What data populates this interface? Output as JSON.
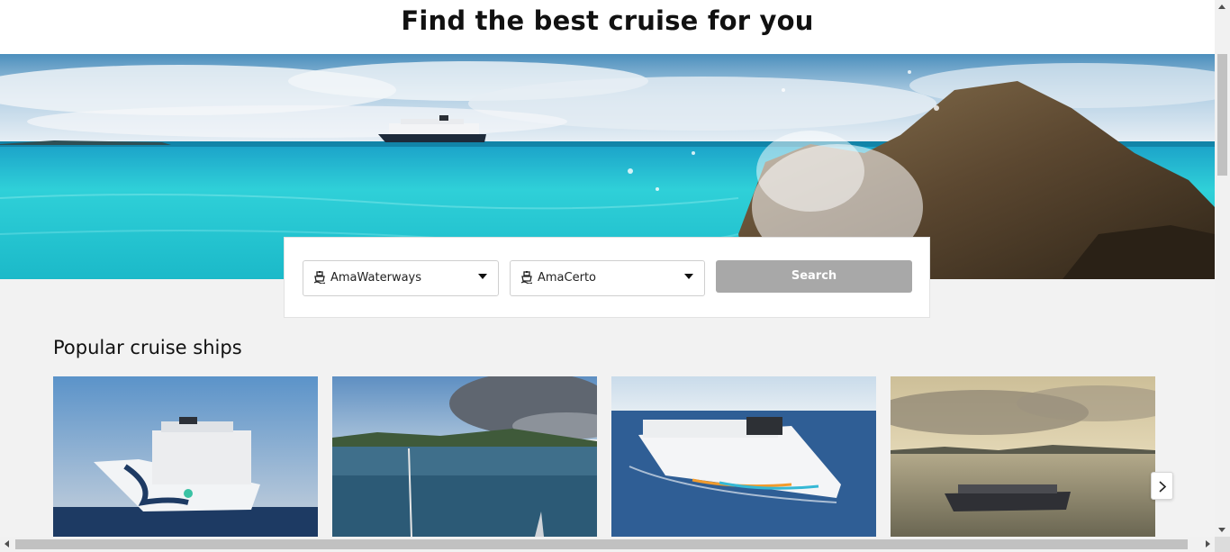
{
  "header": {
    "title": "Find the best cruise for you"
  },
  "search": {
    "cruise_line": {
      "icon": "ship-icon",
      "value": "AmaWaterways"
    },
    "ship": {
      "icon": "ship-icon",
      "value": "AmaCerto"
    },
    "button_label": "Search",
    "button_color": "#a8a8a8"
  },
  "popular": {
    "heading": "Popular cruise ships",
    "cards": [
      {
        "image": "cruise ship with orca artwork at sea"
      },
      {
        "image": "bay with green hills and clouds"
      },
      {
        "image": "white cruise ship sailing on blue sea"
      },
      {
        "image": "cruise ship at sunset near islands"
      }
    ],
    "next_icon": "chevron-right-icon"
  }
}
